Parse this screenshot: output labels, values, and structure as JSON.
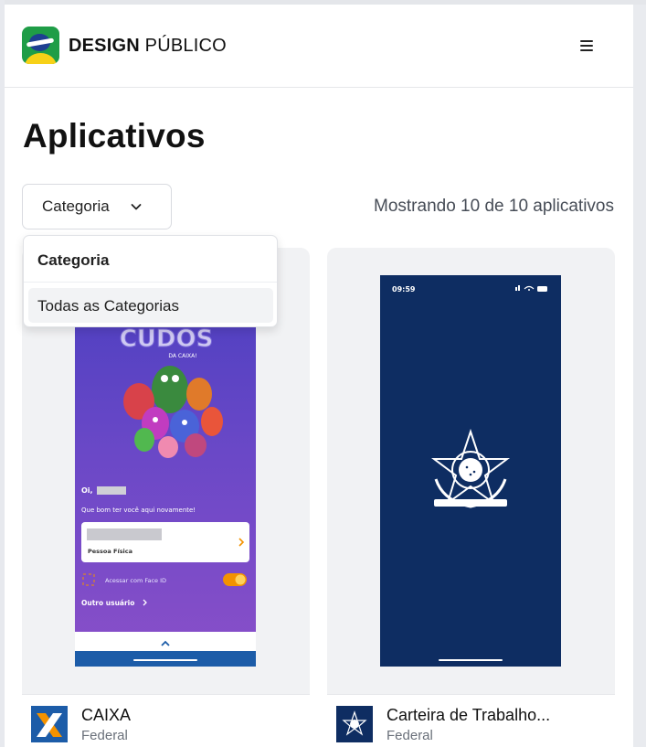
{
  "header": {
    "brand_bold": "DESIGN",
    "brand_regular": "PÚBLICO",
    "logo_icon": "brazil-flag-logo",
    "menu_icon": "hamburger-menu-icon"
  },
  "page": {
    "title": "Aplicativos",
    "count_text": "Mostrando 10 de 10 aplicativos"
  },
  "filter": {
    "button_label": "Categoria",
    "dropdown_header": "Categoria",
    "options": [
      "Todas as Categorias"
    ]
  },
  "apps": [
    {
      "name": "CAIXA",
      "category": "Federal",
      "screen": {
        "greeting": "Oi,",
        "welcome": "Que bom ter você aqui novamente!",
        "account_type": "Pessoa Física",
        "face_id": "Acessar com Face ID",
        "other_user": "Outro usuário",
        "banner_text": "DA CAIXA!"
      }
    },
    {
      "name": "Carteira de Trabalho...",
      "category": "Federal",
      "screen": {
        "time": "09:59"
      }
    }
  ],
  "colors": {
    "caixa_blue": "#1c5ca8",
    "caixa_orange": "#f39200",
    "gov_navy": "#0e2d62"
  }
}
